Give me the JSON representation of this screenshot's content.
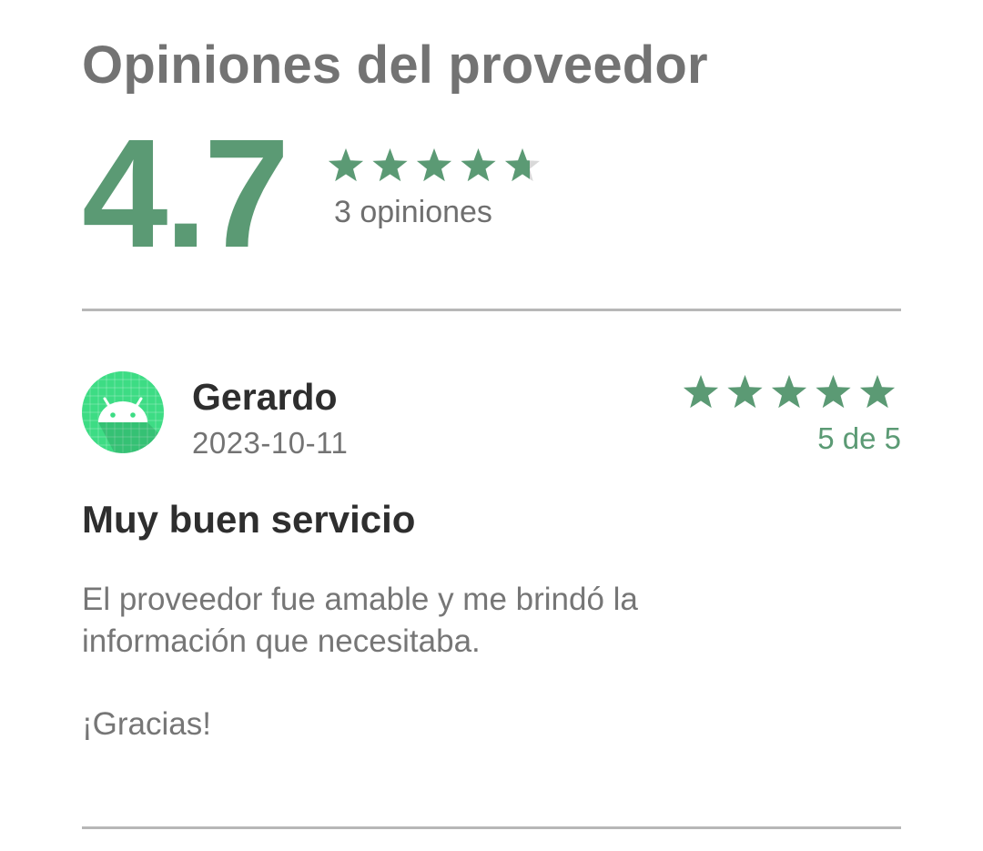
{
  "header": {
    "title": "Opiniones del proveedor"
  },
  "summary": {
    "rating": "4.7",
    "rating_value": 4.7,
    "max_rating": 5,
    "count_label": "3 opiniones"
  },
  "colors": {
    "accent": "#5b9a74",
    "star_empty": "#d9d9d9",
    "divider": "#b7b7b7",
    "avatar_bg": "#3ddc84"
  },
  "reviews": [
    {
      "avatar_icon": "android-icon",
      "name": "Gerardo",
      "date": "2023-10-11",
      "rating_value": 5,
      "score_label": "5 de 5",
      "title": "Muy buen servicio",
      "body": "El proveedor fue amable y me brindó la\ninformación que necesitaba.",
      "closing": "¡Gracias!"
    }
  ]
}
